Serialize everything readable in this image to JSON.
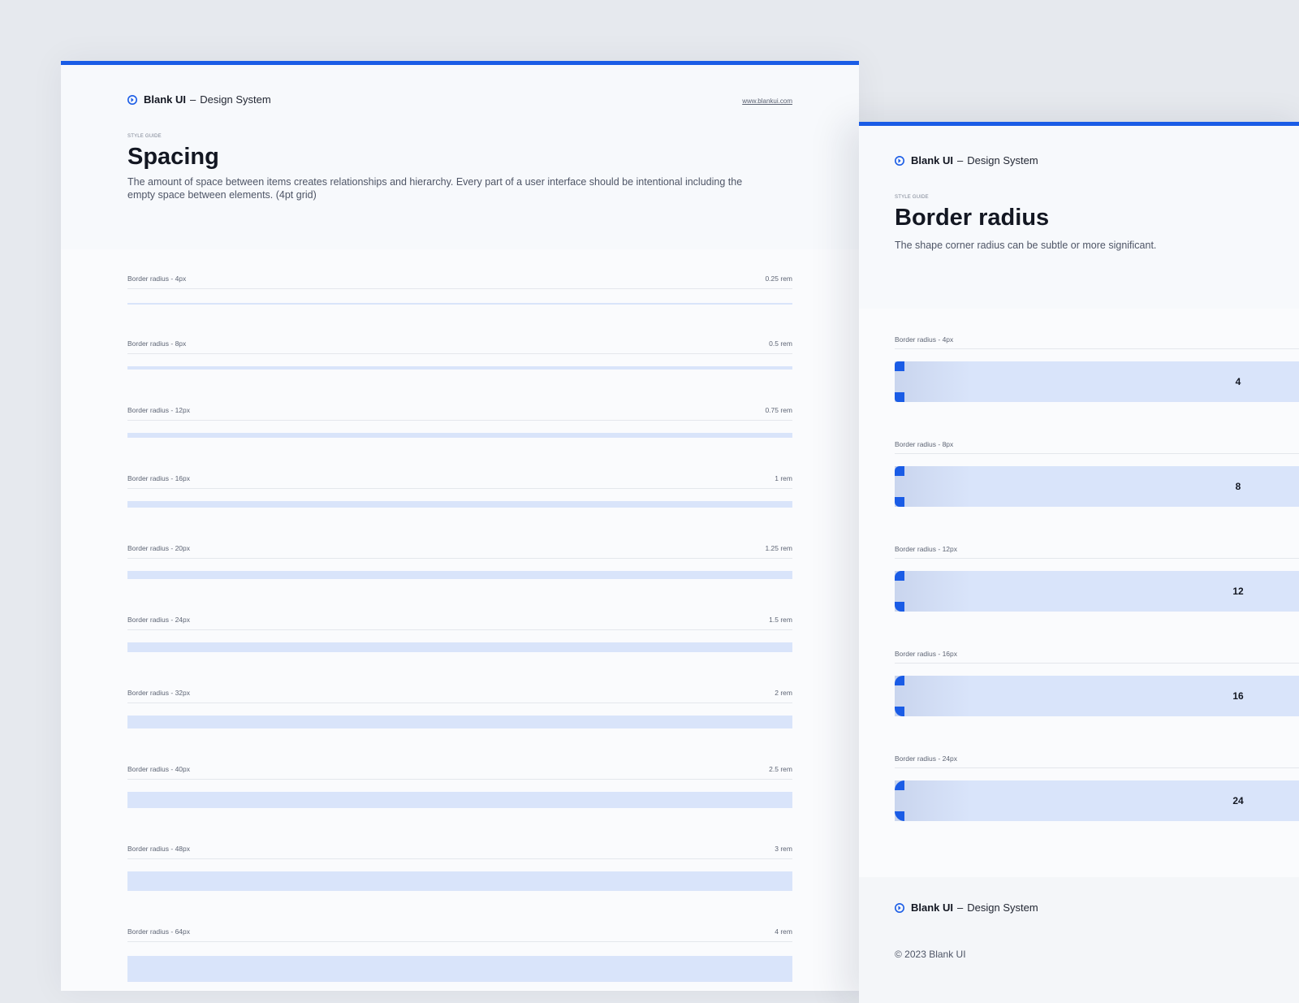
{
  "brand": {
    "name": "Blank UI",
    "separator": "–",
    "tagline": "Design System",
    "url": "www.blankui.com",
    "accent": "#1a5ce6",
    "logo_icon": "blank-ui-logo-icon"
  },
  "spacing_page": {
    "eyebrow": "STYLE GUIDE",
    "title": "Spacing",
    "description": "The amount of space between items creates relationships and hierarchy. Every part of a user interface should be intentional including the empty space between elements. (4pt grid)",
    "rows": [
      {
        "label": "Border radius - 4px",
        "value": "0.25 rem"
      },
      {
        "label": "Border radius - 8px",
        "value": "0.5 rem"
      },
      {
        "label": "Border radius - 12px",
        "value": "0.75 rem"
      },
      {
        "label": "Border radius - 16px",
        "value": "1 rem"
      },
      {
        "label": "Border radius - 20px",
        "value": "1.25 rem"
      },
      {
        "label": "Border radius - 24px",
        "value": "1.5 rem"
      },
      {
        "label": "Border radius - 32px",
        "value": "2 rem"
      },
      {
        "label": "Border radius - 40px",
        "value": "2.5 rem"
      },
      {
        "label": "Border radius - 48px",
        "value": "3 rem"
      },
      {
        "label": "Border radius - 64px",
        "value": "4 rem"
      }
    ]
  },
  "radius_page": {
    "eyebrow": "STYLE GUIDE",
    "title": "Border radius",
    "description": "The shape corner radius can be subtle or more significant.",
    "rows": [
      {
        "label": "Border radius - 4px",
        "value": "4"
      },
      {
        "label": "Border radius - 8px",
        "value": "8"
      },
      {
        "label": "Border radius - 12px",
        "value": "12"
      },
      {
        "label": "Border radius - 16px",
        "value": "16"
      },
      {
        "label": "Border radius - 24px",
        "value": "24"
      }
    ],
    "footer_copyright": "© 2023 Blank UI"
  }
}
